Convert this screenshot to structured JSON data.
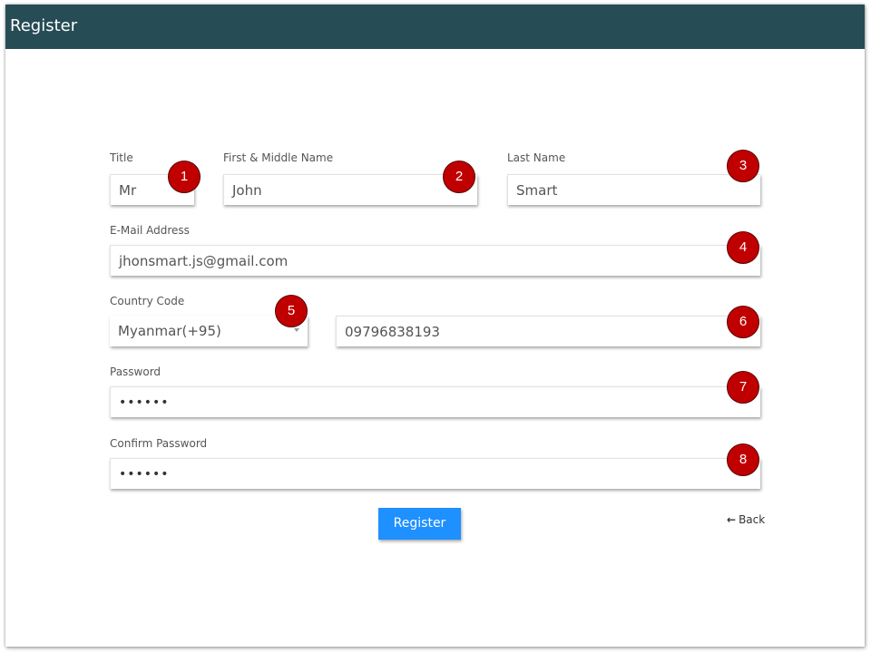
{
  "window": {
    "title": "Register"
  },
  "form": {
    "title_label": "Title",
    "title_value": "Mr",
    "first_name_label": "First & Middle Name",
    "first_name_value": "John",
    "last_name_label": "Last Name",
    "last_name_value": "Smart",
    "email_label": "E-Mail Address",
    "email_value": "jhonsmart.js@gmail.com",
    "country_code_label": "Country Code",
    "country_code_value": "Myanmar(+95)",
    "phone_value": "09796838193",
    "password_label": "Password",
    "password_value": "••••••",
    "confirm_password_label": "Confirm Password",
    "confirm_password_value": "••••••"
  },
  "actions": {
    "register_label": "Register",
    "back_label": "Back",
    "back_icon": "←"
  },
  "callouts": [
    "1",
    "2",
    "3",
    "4",
    "5",
    "6",
    "7",
    "8"
  ],
  "colors": {
    "header": "#264c55",
    "primary_button": "#1e90ff",
    "callout": "#c00000"
  }
}
